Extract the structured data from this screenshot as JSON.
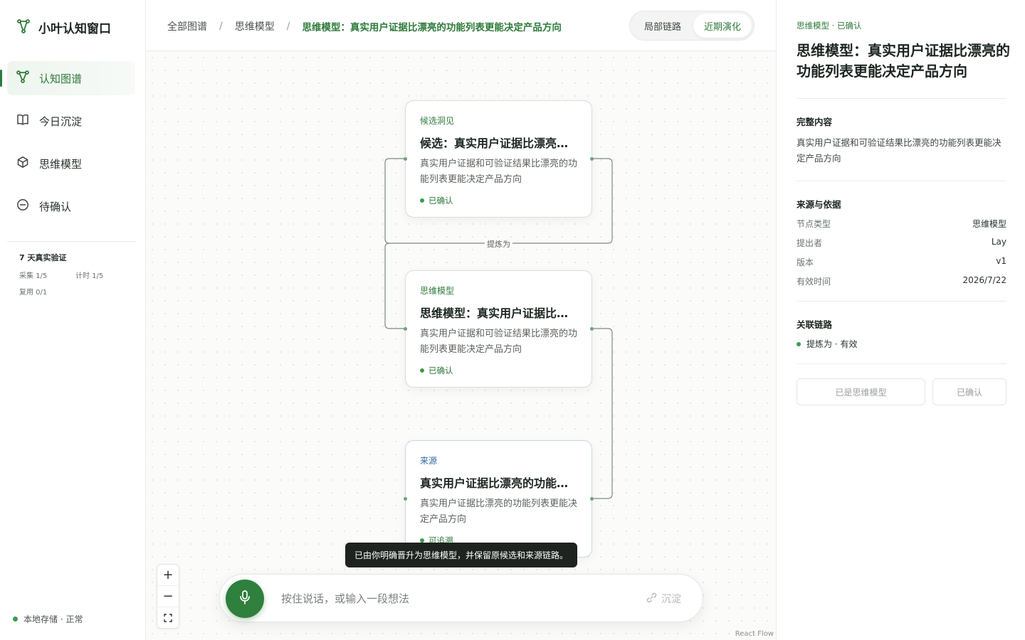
{
  "app": {
    "title": "小叶认知窗口"
  },
  "sidebar": {
    "items": [
      {
        "label": "认知图谱"
      },
      {
        "label": "今日沉淀"
      },
      {
        "label": "思维模型"
      },
      {
        "label": "待确认"
      }
    ],
    "verify": {
      "title": "7 天真实验证",
      "collect": "采集 1/5",
      "timer": "计时 1/5",
      "reuse": "复用 0/1"
    },
    "storage": "本地存储 · 正常"
  },
  "breadcrumb": [
    "全部图谱",
    "思维模型",
    "思维模型：真实用户证据比漂亮的功能列表更能决定产品方向"
  ],
  "view_toggle": {
    "local": "局部链路",
    "recent": "近期演化"
  },
  "nodes": [
    {
      "tag": "候选洞见",
      "title": "候选：真实用户证据比漂亮的功能列表更能决定产品方向",
      "desc": "真实用户证据和可验证结果比漂亮的功能列表更能决定产品方向",
      "status": "已确认"
    },
    {
      "tag": "思维模型",
      "title": "思维模型：真实用户证据比漂亮的功能列表更能决定产品方向",
      "desc": "真实用户证据和可验证结果比漂亮的功能列表更能决定产品方向",
      "status": "已确认"
    },
    {
      "tag": "来源",
      "title": "真实用户证据比漂亮的功能列表更能决定产品方向",
      "desc": "真实用户证据比漂亮的功能列表更能决定产品方向",
      "status": "可追溯"
    }
  ],
  "edge_label": "提炼为",
  "toast": "已由你明确晋升为思维模型，并保留原候选和来源链路。",
  "input": {
    "placeholder": "按住说话，或输入一段想法",
    "settle": "沉淀"
  },
  "attribution": "React Flow",
  "panel": {
    "kicker": "思维模型 · 已确认",
    "title": "思维模型：真实用户证据比漂亮的功能列表更能决定产品方向",
    "content_heading": "完整内容",
    "content": "真实用户证据和可验证结果比漂亮的功能列表更能决定产品方向",
    "source_heading": "来源与依据",
    "fields": [
      {
        "k": "节点类型",
        "v": "思维模型"
      },
      {
        "k": "提出者",
        "v": "Lay"
      },
      {
        "k": "版本",
        "v": "v1"
      },
      {
        "k": "有效时间",
        "v": "2026/7/22"
      }
    ],
    "links_heading": "关联链路",
    "link": "提炼为 · 有效",
    "btn_model": "已是思维模型",
    "btn_confirm": "已确认"
  },
  "colors": {
    "accent": "#2e7a3b",
    "source_tag": "#2f67a8",
    "toast_bg": "#1f2320"
  }
}
